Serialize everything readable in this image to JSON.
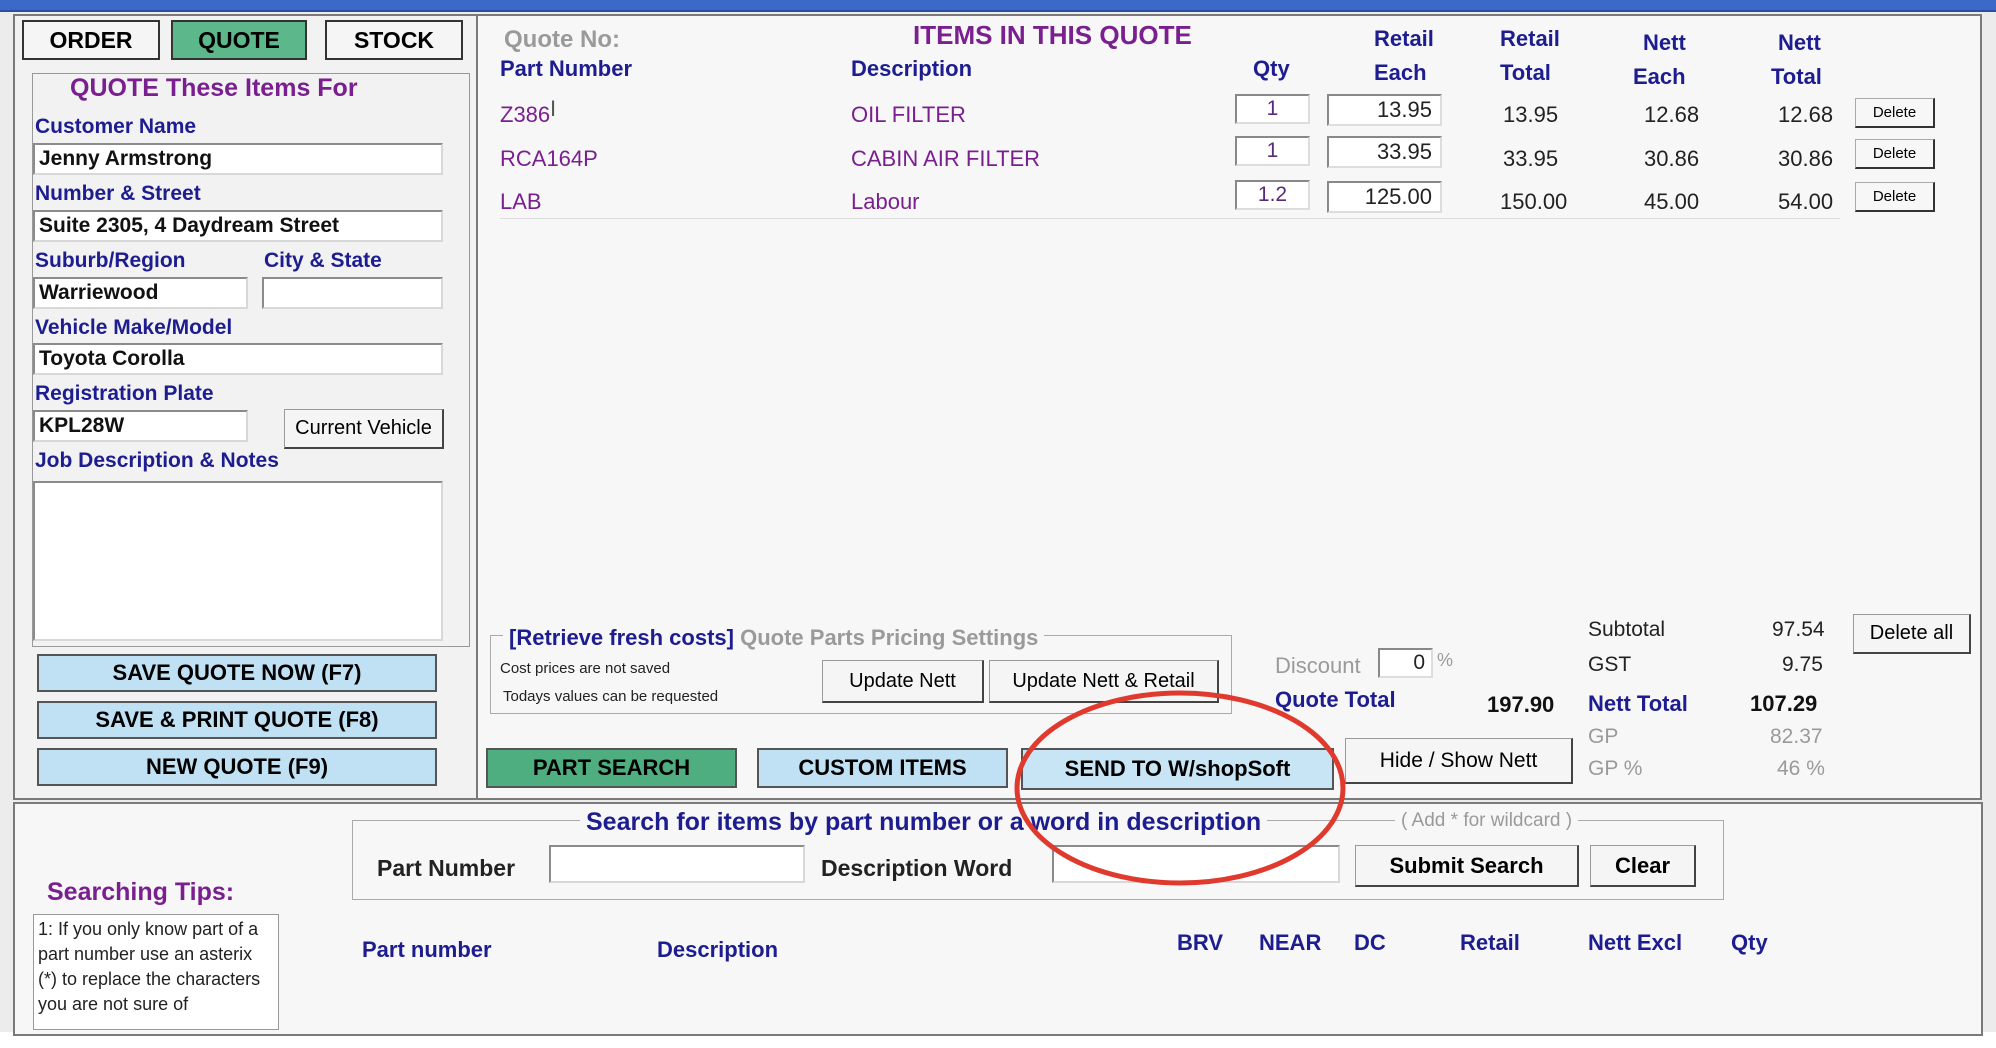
{
  "tabs": {
    "order": "ORDER",
    "quote": "QUOTE",
    "stock": "STOCK"
  },
  "customer": {
    "heading": "QUOTE These Items For",
    "name_label": "Customer Name",
    "name_value": "Jenny Armstrong",
    "street_label": "Number & Street",
    "street_value": "Suite 2305, 4 Daydream Street",
    "suburb_label": "Suburb/Region",
    "suburb_value": "Warriewood",
    "city_label": "City & State",
    "city_value": "",
    "vehicle_label": "Vehicle Make/Model",
    "vehicle_value": "Toyota Corolla",
    "rego_label": "Registration Plate",
    "rego_value": "KPL28W",
    "current_vehicle": "Current Vehicle",
    "notes_label": "Job Description & Notes",
    "notes_value": ""
  },
  "actions": {
    "save": "SAVE QUOTE NOW (F7)",
    "save_print": "SAVE & PRINT QUOTE (F8)",
    "new": "NEW QUOTE (F9)"
  },
  "quote": {
    "quote_no_label": "Quote No:",
    "title": "ITEMS IN THIS QUOTE",
    "headers": {
      "part": "Part Number",
      "desc": "Description",
      "qty": "Qty",
      "retail_each_1": "Retail",
      "retail_each_2": "Each",
      "retail_total_1": "Retail",
      "retail_total_2": "Total",
      "nett_each_1": "Nett",
      "nett_each_2": "Each",
      "nett_total_1": "Nett",
      "nett_total_2": "Total"
    },
    "items": [
      {
        "part": "Z386",
        "desc": "OIL FILTER",
        "qty": "1",
        "retail_each": "13.95",
        "retail_total": "13.95",
        "nett_each": "12.68",
        "nett_total": "12.68",
        "delete": "Delete"
      },
      {
        "part": "RCA164P",
        "desc": "CABIN AIR FILTER",
        "qty": "1",
        "retail_each": "33.95",
        "retail_total": "33.95",
        "nett_each": "30.86",
        "nett_total": "30.86",
        "delete": "Delete"
      },
      {
        "part": "LAB",
        "desc": "Labour",
        "qty": "1.2",
        "retail_each": "125.00",
        "retail_total": "150.00",
        "nett_each": "45.00",
        "nett_total": "54.00",
        "delete": "Delete"
      }
    ]
  },
  "pricing": {
    "retrieve": "[Retrieve fresh costs]",
    "settings": "Quote Parts Pricing Settings",
    "note1": "Cost prices are not saved",
    "note2": "Todays values can be requested",
    "update_nett": "Update Nett",
    "update_nett_retail": "Update Nett & Retail"
  },
  "totals": {
    "discount_label": "Discount",
    "discount_value": "0",
    "discount_unit": "%",
    "quote_total_label": "Quote Total",
    "quote_total_value": "197.90",
    "subtotal_label": "Subtotal",
    "subtotal_value": "97.54",
    "gst_label": "GST",
    "gst_value": "9.75",
    "nett_total_label": "Nett Total",
    "nett_total_value": "107.29",
    "gp_label": "GP",
    "gp_value": "82.37",
    "gp_pct_label": "GP %",
    "gp_pct_value": "46 %",
    "delete_all": "Delete all"
  },
  "bottom_buttons": {
    "part_search": "PART SEARCH",
    "custom_items": "CUSTOM ITEMS",
    "send": "SEND TO W/shopSoft",
    "hide_show": "Hide / Show Nett"
  },
  "search": {
    "legend": "Search for items by part number or a word in description",
    "wildcard": "( Add * for wildcard )",
    "part_label": "Part Number",
    "part_value": "",
    "desc_label": "Description Word",
    "desc_value": "",
    "submit": "Submit Search",
    "clear": "Clear",
    "tips_heading": "Searching Tips:",
    "tips_text": "1: If you only know part of a part number use an asterix (*) to replace the characters you are not sure of",
    "results_headers": {
      "part": "Part number",
      "desc": "Description",
      "brv": "BRV",
      "near": "NEAR",
      "dc": "DC",
      "retail": "Retail",
      "nett": "Nett Excl",
      "qty": "Qty"
    }
  },
  "colors": {
    "accent_purple": "#7a1f8f",
    "label_blue": "#1d1d8f",
    "highlight_circle": "#e03a2e",
    "tab_active": "#5cb88a"
  }
}
